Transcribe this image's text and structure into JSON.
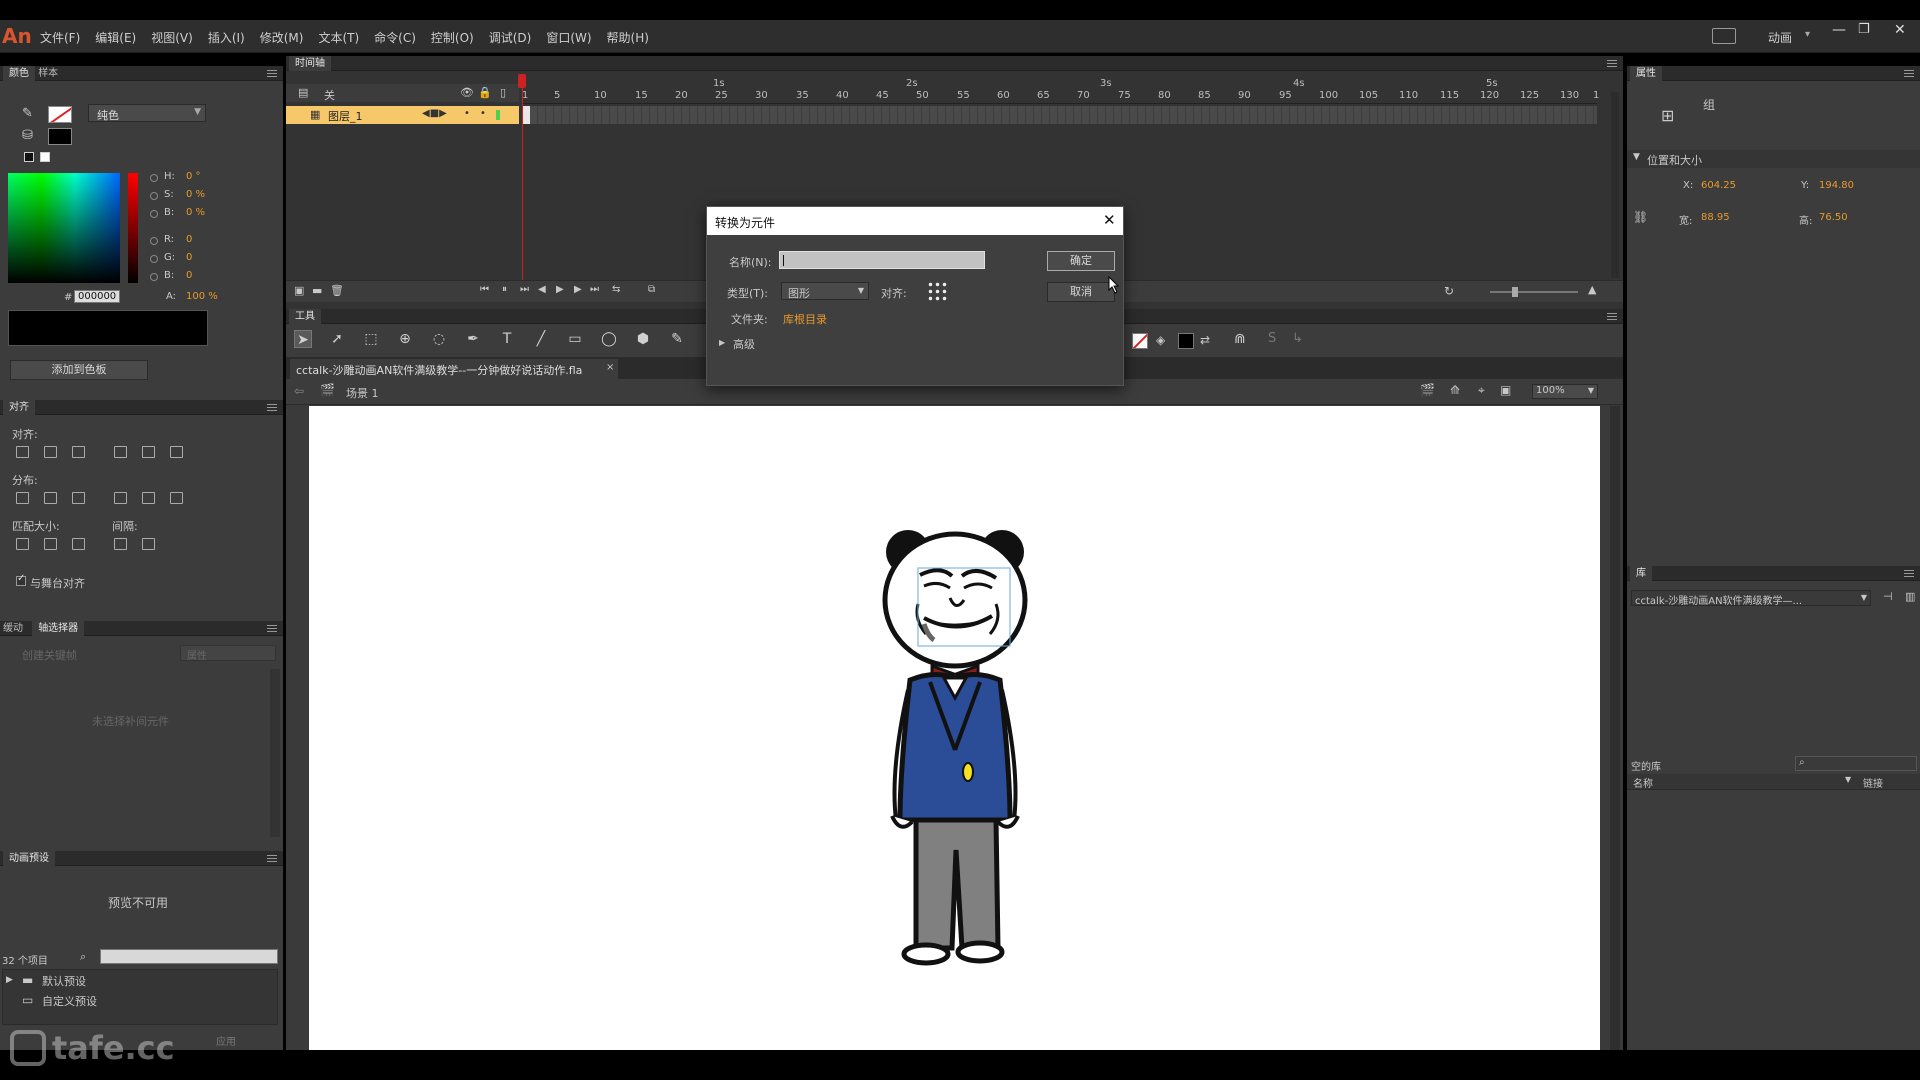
{
  "app": {
    "logo": "An",
    "workspace": "动画"
  },
  "menu": [
    "文件(F)",
    "编辑(E)",
    "视图(V)",
    "插入(I)",
    "修改(M)",
    "文本(T)",
    "命令(C)",
    "控制(O)",
    "调试(D)",
    "窗口(W)",
    "帮助(H)"
  ],
  "color_panel": {
    "tabs": [
      "颜色",
      "样本"
    ],
    "fill_type": "纯色",
    "hsb": [
      {
        "label": "H:",
        "value": "0 °"
      },
      {
        "label": "S:",
        "value": "0 %"
      },
      {
        "label": "B:",
        "value": "0 %"
      }
    ],
    "rgb": [
      {
        "label": "R:",
        "value": "0"
      },
      {
        "label": "G:",
        "value": "0"
      },
      {
        "label": "B:",
        "value": "0"
      }
    ],
    "hex_label": "#",
    "hex": "000000",
    "alpha_label": "A:",
    "alpha": "100 %",
    "add_swatch": "添加到色板"
  },
  "align_panel": {
    "title": "对齐",
    "align_label": "对齐:",
    "distribute_label": "分布:",
    "match_size_label": "匹配大小:",
    "spacing_label": "间隔:",
    "stage_align_label": "与舞台对齐"
  },
  "tween_panel": {
    "tabs": [
      "缓动",
      "轴选择器"
    ],
    "create_keyframe": "创建关键帧",
    "placeholder": "未选择补间元件",
    "dropdown": "属性"
  },
  "motion_presets": {
    "title": "动画预设",
    "preview": "预览不可用",
    "count": "32 个项目",
    "folders": [
      "默认预设",
      "自定义预设"
    ],
    "apply": "应用"
  },
  "timeline": {
    "title": "时间轴",
    "layer_header": "关",
    "layer_name": "图层_1",
    "seconds": [
      "1s",
      "2s",
      "3s",
      "4s",
      "5s"
    ],
    "frames": [
      "1",
      "5",
      "10",
      "15",
      "20",
      "25",
      "30",
      "35",
      "40",
      "45",
      "50",
      "55",
      "60",
      "65",
      "70",
      "75",
      "80",
      "85",
      "90",
      "95",
      "100",
      "105",
      "110",
      "115",
      "120",
      "125",
      "130",
      "1"
    ]
  },
  "tools_panel": {
    "title": "工具",
    "tools": [
      "selection-tool",
      "subselection-tool",
      "free-transform-tool",
      "3d-rotation-tool",
      "lasso-tool",
      "pen-tool",
      "text-tool",
      "line-tool",
      "rectangle-tool",
      "oval-tool",
      "polystar-tool",
      "pencil-tool"
    ]
  },
  "document": {
    "tab": "cctalk-沙雕动画AN软件满级教学--一分钟做好说话动作.fla",
    "scene": "场景 1",
    "zoom": "100%"
  },
  "dialog": {
    "title": "转换为元件",
    "name_label": "名称(N):",
    "name_value": "",
    "type_label": "类型(T):",
    "type_value": "图形",
    "align_label": "对齐:",
    "folder_label": "文件夹:",
    "folder_value": "库根目录",
    "advanced": "高级",
    "ok": "确定",
    "cancel": "取消"
  },
  "properties": {
    "title": "属性",
    "group_label": "组",
    "section": "位置和大小",
    "x_label": "X:",
    "x": "604.25",
    "y_label": "Y:",
    "y": "194.80",
    "w_label": "宽:",
    "w": "88.95",
    "h_label": "高:",
    "h": "76.50"
  },
  "library": {
    "title": "库",
    "doc": "cctalk-沙雕动画AN软件满级教学—...",
    "empty": "空的库",
    "col_name": "名称",
    "col_link": "链接"
  },
  "watermark": "tafe.cc",
  "colors": {
    "accent": "#e79a2c",
    "panel": "#3c3c3c",
    "stage": "#ffffff",
    "playhead": "#cc2222",
    "layer_highlight": "#f7c86a"
  }
}
